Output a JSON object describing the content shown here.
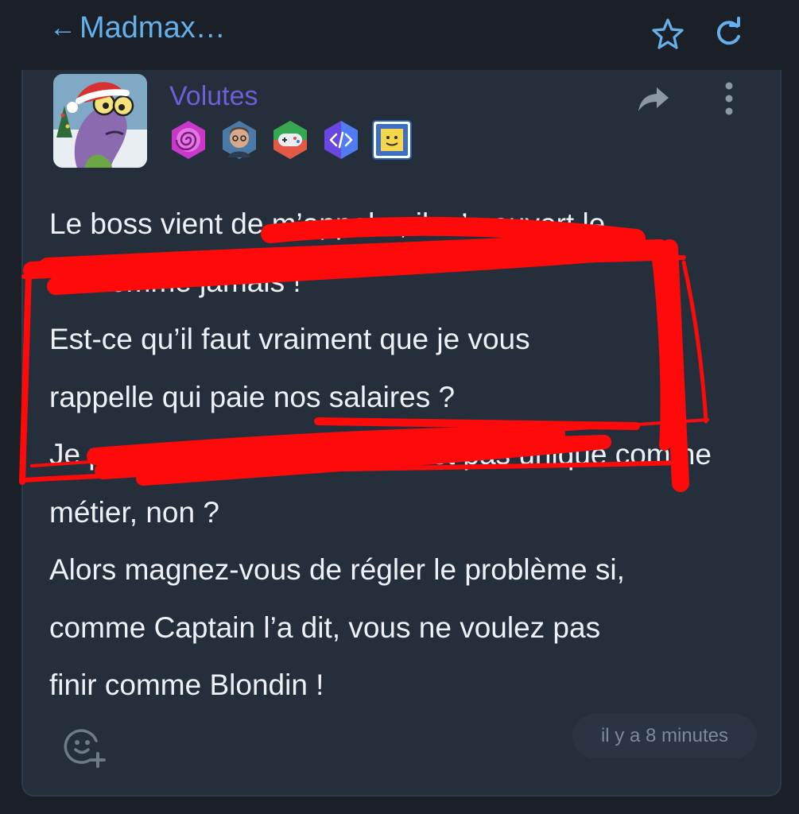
{
  "header": {
    "back_arrow": "←",
    "title": "Madmax…",
    "icons": [
      "star-icon",
      "refresh-icon"
    ]
  },
  "post": {
    "author": "Volutes",
    "avatar": "cartoon-fish-santa-hat-avatar",
    "badges": [
      "spiral-badge-icon",
      "person-portrait-badge-icon",
      "gamepad-badge-icon",
      "code-badge-icon",
      "smiley-card-badge-icon"
    ],
    "actions": [
      "share-icon",
      "more-vertical-icon"
    ],
    "lines": [
      "Le boss vient de m’appeler, il m’a ouvert le",
      "cul comme jamais !",
      "Est-ce qu’il faut vraiment que je vous",
      "rappelle qui paie nos salaires ?",
      "Je pense que le cirque ce n’est pas unique comme",
      "métier, non ?",
      "Alors magnez-vous de régler le problème si,",
      "comme Captain l’a dit, vous ne voulez pas",
      "finir comme Blondin !"
    ],
    "timestamp": "il y a 8 minutes",
    "react_icon": "add-reaction-icon"
  },
  "colors": {
    "background": "#1b2028",
    "card": "#252f3c",
    "accent": "#63b0ea",
    "username": "#6d5fd6",
    "redaction": "#ff0a0a"
  }
}
